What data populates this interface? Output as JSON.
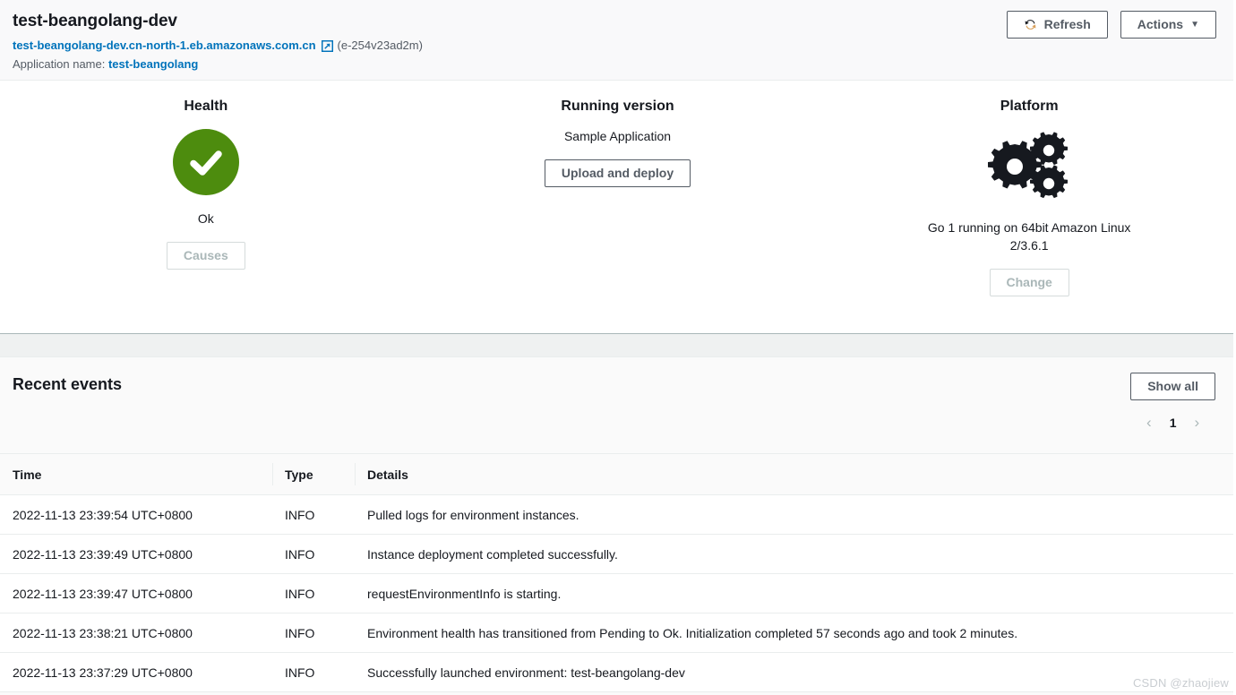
{
  "header": {
    "environment_name": "test-beangolang-dev",
    "environment_url": "test-beangolang-dev.cn-north-1.eb.amazonaws.com.cn",
    "environment_id": "(e-254v23ad2m)",
    "application_name_label": "Application name:",
    "application_name": "test-beangolang",
    "refresh_label": "Refresh",
    "actions_label": "Actions",
    "actions_caret": "▼",
    "external_link_icon": "external-link-icon",
    "refresh_icon": "refresh-icon"
  },
  "overview": {
    "health": {
      "title": "Health",
      "status": "Ok",
      "status_icon": "check-circle-icon",
      "status_color": "#4d8c0e",
      "causes_label": "Causes",
      "causes_disabled": true
    },
    "running_version": {
      "title": "Running version",
      "version_label": "Sample Application",
      "upload_label": "Upload and deploy"
    },
    "platform": {
      "title": "Platform",
      "icon": "gears-icon",
      "description": "Go 1 running on 64bit Amazon Linux 2/3.6.1",
      "change_label": "Change",
      "change_disabled": true
    }
  },
  "events": {
    "title": "Recent events",
    "show_all_label": "Show all",
    "pagination": {
      "prev_icon": "chevron-left-icon",
      "next_icon": "chevron-right-icon",
      "current_page": "1"
    },
    "columns": [
      "Time",
      "Type",
      "Details"
    ],
    "rows": [
      {
        "time": "2022-11-13 23:39:54 UTC+0800",
        "type": "INFO",
        "details": "Pulled logs for environment instances."
      },
      {
        "time": "2022-11-13 23:39:49 UTC+0800",
        "type": "INFO",
        "details": "Instance deployment completed successfully."
      },
      {
        "time": "2022-11-13 23:39:47 UTC+0800",
        "type": "INFO",
        "details": "requestEnvironmentInfo is starting."
      },
      {
        "time": "2022-11-13 23:38:21 UTC+0800",
        "type": "INFO",
        "details": "Environment health has transitioned from Pending to Ok. Initialization completed 57 seconds ago and took 2 minutes."
      },
      {
        "time": "2022-11-13 23:37:29 UTC+0800",
        "type": "INFO",
        "details": "Successfully launched environment: test-beangolang-dev"
      }
    ]
  },
  "watermark": "CSDN @zhaojiew",
  "colors": {
    "link": "#0073bb",
    "health_green": "#4d8c0e",
    "info_green": "#5b8a1e",
    "text": "#16191f",
    "muted": "#545b64",
    "border": "#eaeded"
  }
}
